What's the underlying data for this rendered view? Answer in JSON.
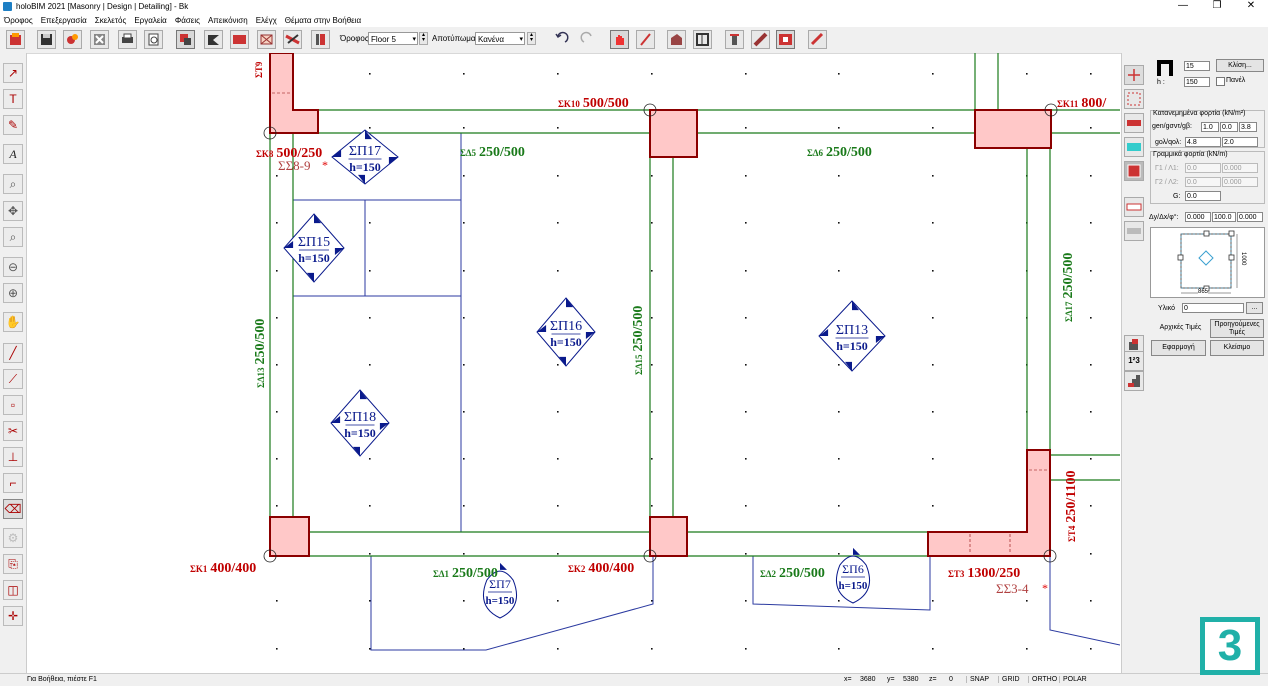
{
  "window": {
    "title": "holoBIM 2021 [Masonry | Design | Detailing] - Bk",
    "controls": [
      "—",
      "❐",
      "✕"
    ]
  },
  "menu": [
    "Όροφος",
    "Επεξεργασία",
    "Σκελετός",
    "Εργαλεία",
    "Φάσεις",
    "Απεικόνιση",
    "Ελέγχ",
    "Θέματα στην Βοήθεια"
  ],
  "toolbar": {
    "floor_label": "Όροφος",
    "floor_value": "Floor 5",
    "footprint_label": "Αποτύπωμα",
    "footprint_value": "Κανένα"
  },
  "plan": {
    "columns": [
      {
        "id": "ΣΚ8",
        "size": "500/250"
      },
      {
        "id": "ΣΚ10",
        "size": "500/500"
      },
      {
        "id": "ΣΚ11",
        "size": "800/"
      },
      {
        "id": "ΣΚ1",
        "size": "400/400"
      },
      {
        "id": "ΣΚ2",
        "size": "400/400"
      },
      {
        "id": "ΣΤ3",
        "size": "1300/250"
      },
      {
        "id": "ΣΤ4",
        "size": "250/1100"
      },
      {
        "id": "ΣΤ9",
        "size": ""
      }
    ],
    "beams": [
      {
        "id": "ΣΔ5",
        "size": "250/500"
      },
      {
        "id": "ΣΔ6",
        "size": "250/500"
      },
      {
        "id": "ΣΔ13",
        "size": "250/500"
      },
      {
        "id": "ΣΔ15",
        "size": "250/500"
      },
      {
        "id": "ΣΔ17",
        "size": "250/500"
      },
      {
        "id": "ΣΔ1",
        "size": "250/500"
      },
      {
        "id": "ΣΔ2",
        "size": "250/500"
      }
    ],
    "slabs": [
      {
        "id": "ΣΠ17",
        "h": "h=150"
      },
      {
        "id": "ΣΠ15",
        "h": "h=150"
      },
      {
        "id": "ΣΠ16",
        "h": "h=150"
      },
      {
        "id": "ΣΠ13",
        "h": "h=150"
      },
      {
        "id": "ΣΠ18",
        "h": "h=150"
      },
      {
        "id": "ΣΠ7",
        "h": "h=150"
      },
      {
        "id": "ΣΠ6",
        "h": "h=150"
      }
    ],
    "joints": [
      "ΣΣ8-9",
      "ΣΣ3-4"
    ],
    "asterisk": "*"
  },
  "panel": {
    "width_value": "15",
    "h_label": "h :",
    "h_value": "150",
    "slope_button": "Κλίση...",
    "panel_checkbox": "Πανέλ",
    "distributed_title": "Κατανεμημένα φορτία (kN/m²)",
    "gen_label": "gen/gσντ/gβ:",
    "gen_values": [
      "1.0",
      "0.0",
      "3.8"
    ],
    "q_label": "gολ/qολ:",
    "q_values": [
      "4.8",
      "2.0"
    ],
    "linear_title": "Γραμμικά φορτία (kN/m)",
    "g1_label": "Γ1 / Λ1:",
    "g1_values": [
      "0.0",
      "0.000"
    ],
    "g2_label": "Γ2 / Λ2:",
    "g2_values": [
      "0.0",
      "0.000"
    ],
    "g_label": "G:",
    "g_value": "0.0",
    "offset_label": "Δy/Δx/φ°:",
    "offset_values": [
      "0.000",
      "100.0",
      "0.000"
    ],
    "dim_right": "1000",
    "dim_bottom": "865",
    "material_label": "Υλικό",
    "material_value": "0",
    "ellipsis": "...",
    "initial_button": "Αρχικές Τιμές",
    "previous_button": "Προηγούμενες Τιμές",
    "apply_button": "Εφαρμογή",
    "close_button": "Κλείσιμο",
    "numbering_icon": "1²3"
  },
  "status": {
    "help": "Για Βοήθεια, πιέστε F1",
    "x_label": "x=",
    "x_value": "3680",
    "y_label": "y=",
    "y_value": "5380",
    "z_label": "z=",
    "z_value": "0",
    "modes": [
      "SNAP",
      "GRID",
      "ORTHO",
      "POLAR"
    ]
  },
  "badge": "3",
  "colors": {
    "column_border": "#8b0000",
    "column_fill": "#ffc8c8",
    "beam_line": "#1a7a1a",
    "beam_text": "#1a7a1a",
    "column_text": "#c00000",
    "slab_blue": "#0a1a8c",
    "badge": "#20b0a8"
  }
}
